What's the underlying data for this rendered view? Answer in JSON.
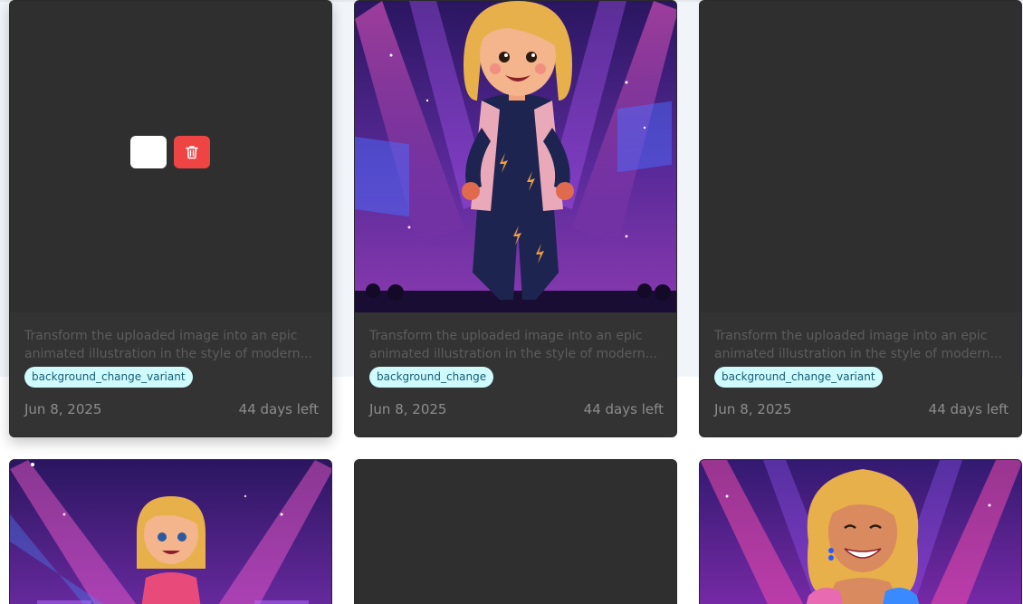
{
  "cards": [
    {
      "prompt_line1": "Transform the uploaded image into an epic",
      "prompt_line2": "animated illustration in the style of modern...",
      "tag": "background_change_variant",
      "date": "Jun 8, 2025",
      "days_left": "44 days left",
      "has_image": false,
      "hover_actions": true
    },
    {
      "prompt_line1": "Transform the uploaded image into an epic",
      "prompt_line2": "animated illustration in the style of modern...",
      "tag": "background_change",
      "date": "Jun 8, 2025",
      "days_left": "44 days left",
      "has_image": true,
      "image_icon": "cartoon-girl-on-stage-icon"
    },
    {
      "prompt_line1": "Transform the uploaded image into an epic",
      "prompt_line2": "animated illustration in the style of modern...",
      "tag": "background_change_variant",
      "date": "Jun 8, 2025",
      "days_left": "44 days left",
      "has_image": false
    },
    {
      "has_image": true,
      "image_icon": "cartoon-girl-on-stage-icon"
    },
    {
      "has_image": false
    },
    {
      "has_image": true,
      "image_icon": "cartoon-woman-on-stage-icon"
    }
  ],
  "colors": {
    "card_bg": "#333333",
    "tag_bg": "#cffafe",
    "tag_text": "#155e75",
    "delete_button": "#ef4444",
    "page_band": "#f1f5f9"
  },
  "icons": {
    "delete": "trash-icon"
  }
}
